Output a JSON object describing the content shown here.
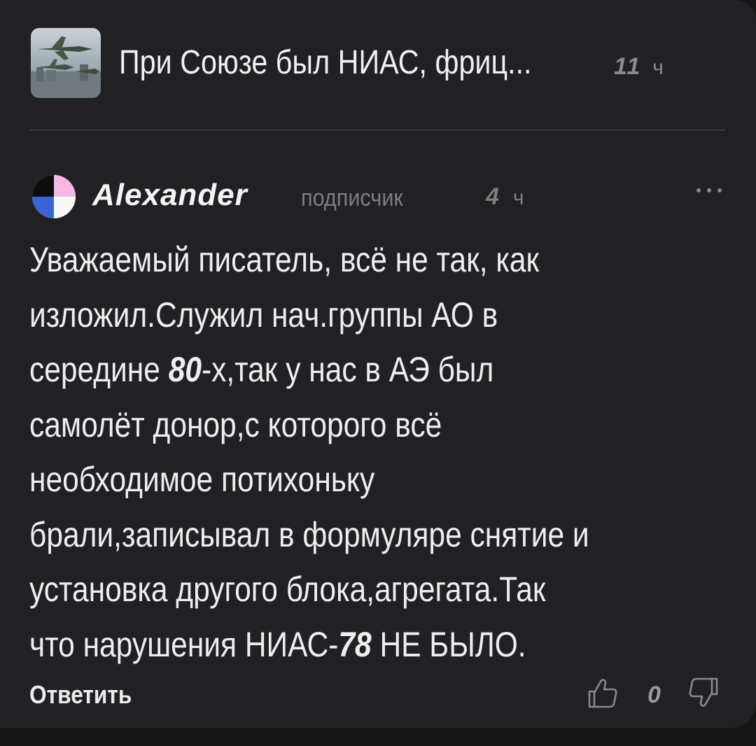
{
  "article": {
    "thumbnail_icon": "airplane-thumbnail",
    "title": "При Союзе был НИАС, фриц...",
    "time_value": "11",
    "time_unit": "ч"
  },
  "comment": {
    "author": "Alexander",
    "role": "подписчик",
    "time_value": "4",
    "time_unit": "ч",
    "more_icon": "more-dots-icon",
    "lines": [
      [
        "Уважаемый писатель, всё не так, как"
      ],
      [
        "изложил.Служил нач.группы АО в"
      ],
      [
        "середине ",
        "80",
        "-х,так у нас в АЭ был"
      ],
      [
        "самолёт донор,с которого всё"
      ],
      [
        "необходимое потихоньку"
      ],
      [
        "брали,записывал в формуляре снятие и"
      ],
      [
        "установка другого блока,агрегата.Так"
      ],
      [
        "что нарушения НИАС-",
        "78",
        " НЕ БЫЛО."
      ]
    ]
  },
  "footer": {
    "reply_label": "Ответить",
    "like_icon": "thumbs-up-icon",
    "rating": "0",
    "dislike_icon": "thumbs-down-icon"
  },
  "colors": {
    "background": "#212123",
    "text": "#eeeeee",
    "muted": "#7e7e7e",
    "avatar_pink": "#f4b8e4",
    "avatar_blue": "#3a63d8"
  }
}
